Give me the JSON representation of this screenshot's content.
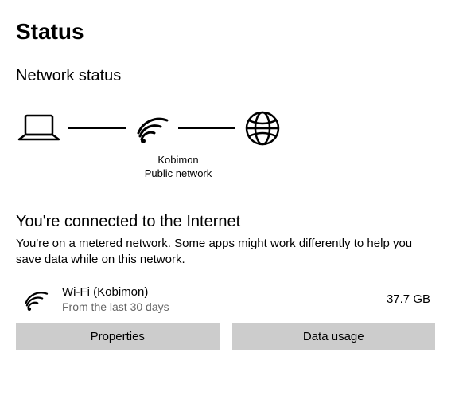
{
  "page": {
    "title": "Status",
    "section_title": "Network status"
  },
  "diagram": {
    "network_name": "Kobimon",
    "network_type": "Public network"
  },
  "status": {
    "headline": "You're connected to the Internet",
    "description": "You're on a metered network. Some apps might work differently to help you save data while on this network."
  },
  "connection": {
    "name": "Wi-Fi (Kobimon)",
    "subtext": "From the last 30 days",
    "usage": "37.7 GB"
  },
  "buttons": {
    "properties": "Properties",
    "data_usage": "Data usage"
  }
}
